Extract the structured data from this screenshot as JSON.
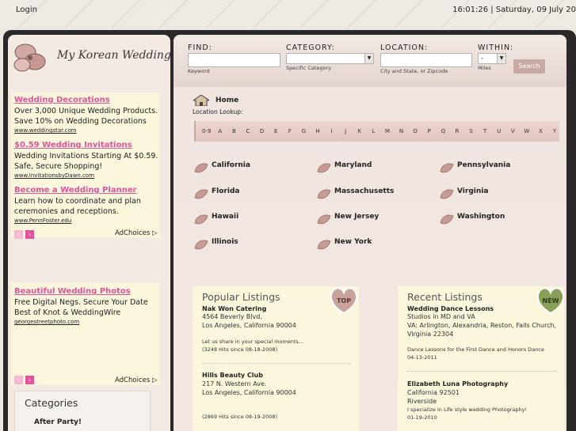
{
  "topbar": {
    "login": "Login",
    "clock": "16:01:26 | Saturday, 09 July 20"
  },
  "logo": {
    "text": "My Korean Wedding"
  },
  "ads": [
    {
      "title": "Wedding Decorations",
      "text": "Over 3,000 Unique Wedding Products. Save 10% on Wedding Decorations",
      "url": "www.weddingstar.com"
    },
    {
      "title": "$0.59 Wedding Invitations",
      "text": "Wedding Invitations Starting At $0.59. Safe, Secure Shopping!",
      "url": "www.InvitationsbyDawn.com"
    },
    {
      "title": "Become a Wedding Planner",
      "text": "Learn how to coordinate and plan ceremonies and receptions.",
      "url": "www.PennFoster.edu"
    },
    {
      "title": "Beautiful Wedding Photos",
      "text": "Free Digital Negs. Secure Your Date Best of Knot & WeddingWire",
      "url": "georgestreetphoto.com"
    }
  ],
  "adchoices": "AdChoices",
  "adchoices_icon": "triangle-play-icon",
  "categories": {
    "title": "Categories",
    "first_item": "After Party!"
  },
  "search": {
    "find_label": "FIND:",
    "find_sub": "Keyword",
    "category_label": "CATEGORY:",
    "category_sub": "Specific Category",
    "location_label": "LOCATION:",
    "location_sub": "City and State, or Zipcode",
    "within_label": "WITHIN:",
    "within_value": "-",
    "within_sub": "Miles",
    "button": "Search"
  },
  "breadcrumb": {
    "home": "Home",
    "lookup": "Location Lookup:"
  },
  "alphabet": [
    "0-9",
    "A",
    "B",
    "C",
    "D",
    "E",
    "F",
    "G",
    "H",
    "I",
    "J",
    "K",
    "L",
    "M",
    "N",
    "O",
    "P",
    "Q",
    "R",
    "S",
    "T",
    "U",
    "V",
    "W",
    "X",
    "Y"
  ],
  "states": [
    [
      "California",
      "Maryland",
      "Pennsylvania"
    ],
    [
      "Florida",
      "Massachusetts",
      "Virginia"
    ],
    [
      "Hawaii",
      "New Jersey",
      "Washington"
    ],
    [
      "Illinois",
      "New York",
      ""
    ]
  ],
  "popular": {
    "title": "Popular Listings",
    "badge": "TOP",
    "items": [
      {
        "name": "Nak Won Catering",
        "addr1": "4564 Beverly Blvd.",
        "addr2": "Los Angeles, California 90004",
        "desc": "Let us share in your special moments...",
        "hits": "(3248 Hits since 08-18-2008)"
      },
      {
        "name": "Hills Beauty Club",
        "addr1": "217 N. Western Ave.",
        "addr2": "Los Angeles, California 90004",
        "desc": "",
        "hits": "(2869 Hits since 08-19-2008)"
      }
    ]
  },
  "recent": {
    "title": "Recent Listings",
    "badge": "NEW",
    "items": [
      {
        "name": "Wedding Dance Lessons",
        "addr1": "Studios in MD and VA",
        "addr2": "VA: Arlington, Alexandria, Reston, Falls Church, Virginia 22304",
        "desc": "Dance Lessons for the First Dance and Honors Dance",
        "date": "04-13-2011"
      },
      {
        "name": "Elizabeth Luna Photography",
        "addr1": "California 92501",
        "addr2": "Riverside",
        "desc": "I specialize in Life style wedding Photography!",
        "date": "01-19-2010"
      }
    ]
  },
  "colors": {
    "ad_title": "#e0559a",
    "frame": "#2c2827",
    "ad_bg": "#fbf6dc",
    "badge_top": "#c9a29b",
    "badge_new": "#8aa05a"
  }
}
